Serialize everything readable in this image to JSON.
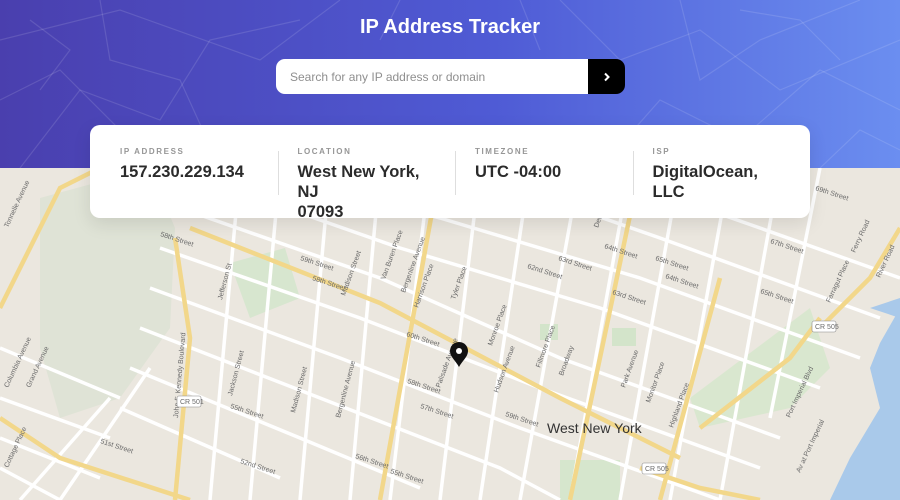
{
  "header": {
    "title": "IP Address Tracker",
    "search_placeholder": "Search for any IP address or domain",
    "search_value": ""
  },
  "info": {
    "ip_label": "IP ADDRESS",
    "ip_value": "157.230.229.134",
    "location_label": "LOCATION",
    "location_line1": "West New York, NJ",
    "location_line2": "07093",
    "timezone_label": "TIMEZONE",
    "timezone_value": "UTC -04:00",
    "isp_label": "ISP",
    "isp_value": "DigitalOcean, LLC"
  },
  "map": {
    "city_label": "West New York",
    "streets": {
      "s58": "58th Street",
      "s59": "59th Street",
      "s60": "60th Street",
      "s62": "62nd Street",
      "s64": "64th Street",
      "s65": "65th Street",
      "s66": "66th Street",
      "s67": "67th Street",
      "s68": "68th Street",
      "s69": "69th Street",
      "s63": "63rd Street",
      "s55": "55th Street",
      "s56": "56th Street",
      "s57": "57th Street",
      "s52": "52nd Street",
      "s51": "51st Street",
      "s54": "54th Street",
      "tonnelle": "Tonnelle Avenue",
      "jfk": "John F. Kennedy Boulevard",
      "jefferson": "Jefferson St",
      "vanburen": "Van Buren Place",
      "madison": "Madison Street",
      "bergenline": "Bergenline Avenue",
      "harrison": "Harrison Place",
      "tyler": "Tyler Place",
      "palisade": "Palisade Avenue",
      "hudson": "Hudson Avenue",
      "monroe": "Monroe Place",
      "fillmore": "Fillmore Place",
      "broadway": "Broadway",
      "park": "Park Avenue",
      "monitor": "Monitor Place",
      "highland": "Highland Place",
      "jackson": "Jackson Street",
      "columbia": "Columbia Avenue",
      "grand": "Grand Avenue",
      "cottage": "Cottage Place",
      "portimperial": "Port Imperial Blvd",
      "avport": "Av at Port Imperial",
      "farragut": "Farragut Place",
      "ferry": "Ferry Road",
      "river": "River Road",
      "dewey": "Dewey Avenue",
      "cr501": "CR 501",
      "cr505a": "CR 505",
      "cr505b": "CR 505"
    }
  }
}
